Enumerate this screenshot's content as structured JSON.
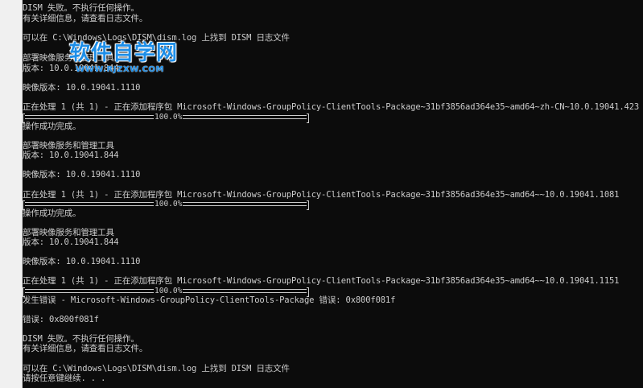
{
  "watermark": {
    "title": "软件自学网",
    "url": "WWW.RJZXW.COM"
  },
  "console": {
    "lines": [
      "DISM 失败。不执行任何操作。",
      "有关详细信息，请查看日志文件。",
      "",
      "可以在 C:\\Windows\\Logs\\DISM\\dism.log 上找到 DISM 日志文件",
      "",
      "部署映像服务和管理工具",
      "版本: 10.0.19041.844",
      "",
      "映像版本: 10.0.19041.1110",
      "",
      "正在处理 1 (共 1) - 正在添加程序包 Microsoft-Windows-GroupPolicy-ClientTools-Package~31bf3856ad364e35~amd64~zh-CN~10.0.19041.423",
      "",
      "操作成功完成。",
      "",
      "部署映像服务和管理工具",
      "版本: 10.0.19041.844",
      "",
      "映像版本: 10.0.19041.1110",
      "",
      "正在处理 1 (共 1) - 正在添加程序包 Microsoft-Windows-GroupPolicy-ClientTools-Package~31bf3856ad364e35~amd64~~10.0.19041.1081",
      "",
      "操作成功完成。",
      "",
      "部署映像服务和管理工具",
      "版本: 10.0.19041.844",
      "",
      "映像版本: 10.0.19041.1110",
      "",
      "正在处理 1 (共 1) - 正在添加程序包 Microsoft-Windows-GroupPolicy-ClientTools-Package~31bf3856ad364e35~amd64~~10.0.19041.1151",
      "",
      "发生错误 - Microsoft-Windows-GroupPolicy-ClientTools-Package 错误: 0x800f081f",
      "",
      "错误: 0x800f081f",
      "",
      "DISM 失败。不执行任何操作。",
      "有关详细信息，请查看日志文件。",
      "",
      "可以在 C:\\Windows\\Logs\\DISM\\dism.log 上找到 DISM 日志文件",
      "请按任意键继续. . ."
    ],
    "progress": [
      {
        "label": "100.0%",
        "value": 1.0
      },
      {
        "label": "100.0%",
        "value": 1.0
      },
      {
        "label": "100.0%",
        "value": 1.0
      }
    ]
  }
}
